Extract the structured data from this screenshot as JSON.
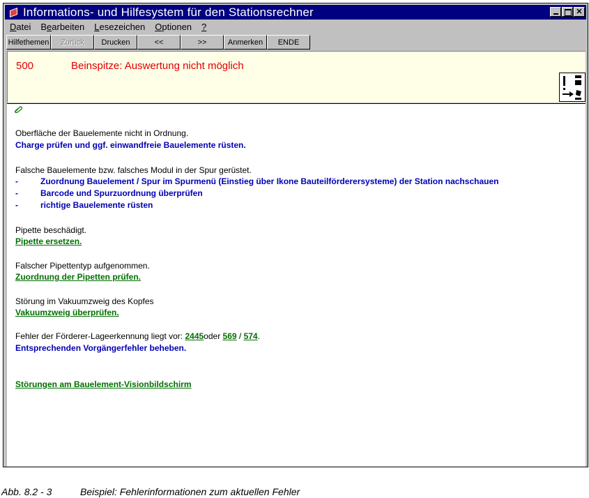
{
  "window": {
    "title": "Informations- und Hilfesystem für den Stationsrechner"
  },
  "menu": [
    {
      "label": "Datei",
      "mnemonic_index": 0
    },
    {
      "label": "Bearbeiten",
      "mnemonic_index": 1
    },
    {
      "label": "Lesezeichen",
      "mnemonic_index": 0
    },
    {
      "label": "Optionen",
      "mnemonic_index": 0
    },
    {
      "label": "?",
      "mnemonic_index": 0
    }
  ],
  "toolbar": {
    "help_topics": "Hilfethemen",
    "back": "Zurück",
    "print": "Drucken",
    "prev": "<<",
    "next": ">>",
    "annotate": "Anmerken",
    "end": "ENDE"
  },
  "error": {
    "code": "500",
    "title": "Beinspitze: Auswertung nicht möglich"
  },
  "content": {
    "cause1": "Oberfläche der Bauelemente nicht in Ordnung.",
    "action1": "Charge prüfen und ggf. einwandfreie Bauelemente rüsten.",
    "cause2": "Falsche Bauelemente bzw. falsches Modul in der Spur gerüstet.",
    "bullets": [
      {
        "dash": "-",
        "text": "Zuordnung Bauelement / Spur im Spurmenü (Einstieg über Ikone Bauteilförderersysteme) der Station nachschauen"
      },
      {
        "dash": "-",
        "text": "Barcode und Spurzuordnung überprüfen"
      },
      {
        "dash": "-",
        "text": "richtige Bauelemente rüsten"
      }
    ],
    "cause3": "Pipette beschädigt.",
    "link3": "Pipette ersetzen.",
    "cause4": "Falscher Pipettentyp aufgenommen.",
    "link4": "Zuordnung der Pipetten prüfen.",
    "cause5": "Störung im Vakuumzweig des Kopfes",
    "link5": "Vakuumzweig überprüfen.",
    "cause6_prefix": "Fehler der Förderer-Lageerkennung liegt vor: ",
    "cause6_link_a": "2445",
    "cause6_mid": "oder ",
    "cause6_link_b": "569",
    "cause6_sep": " / ",
    "cause6_link_c": "574",
    "cause6_end": ".",
    "action6": "Entsprechenden Vorgängerfehler beheben.",
    "link_final": "Störungen am Bauelement-Visionbildschirm"
  },
  "caption": {
    "number": "Abb. 8.2 - 3",
    "text": "Beispiel: Fehlerinformationen zum aktuellen Fehler"
  }
}
